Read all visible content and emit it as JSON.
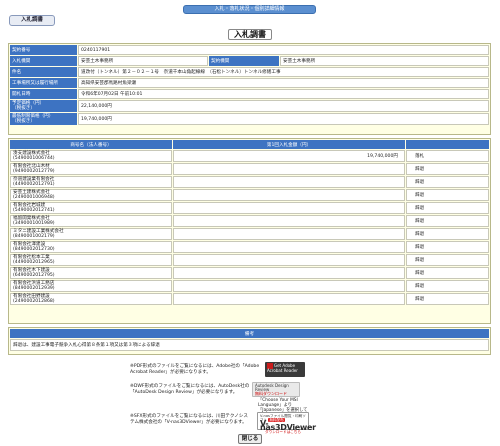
{
  "header": {
    "bar_title": "入札・落札状況・個別詳細情報",
    "tab_label": "入札調書",
    "page_title": "入札調書"
  },
  "info": {
    "rows": [
      {
        "label": "契約番号",
        "value": "0240117901"
      },
      {
        "label": "入札機関",
        "value": "安芸土木事務所",
        "label2": "契約機関",
        "value2": "安芸土木事務所"
      },
      {
        "label": "件名",
        "value": "道改付（トンネル）第２－０２－１号　奈道千本山角起線線　（石松トンネル）トンネル修繕工事"
      },
      {
        "label": "工事場所又は履行場所",
        "value": "高知県安芸郡馬路村魚梁瀬"
      },
      {
        "label": "開札日時",
        "value": "令和6年07月02日 午前10:01"
      },
      {
        "label": "予定価格（円）\n（税抜き）",
        "value": "22,140,000円"
      },
      {
        "label": "最低制限価格（円）\n（税抜き）",
        "value": "19,740,000円"
      }
    ]
  },
  "bids": {
    "headers": [
      "商号名（法人番号）",
      "第1回入札金額（円）",
      ""
    ],
    "rows": [
      {
        "name": "湊支建設株式会社",
        "id": "(5490001006744)",
        "amount": "19,740,000円",
        "result": "落札"
      },
      {
        "name": "有限会社北山木材",
        "id": "(9490002012779)",
        "amount": "",
        "result": "辞退"
      },
      {
        "name": "奈道建設業有限会社",
        "id": "(4490002012791)",
        "amount": "",
        "result": "辞退"
      },
      {
        "name": "安芸土建株式会社",
        "id": "(2490001006948)",
        "amount": "",
        "result": "辞退"
      },
      {
        "name": "有限会社岩城建",
        "id": "(5490002012741)",
        "amount": "",
        "result": "辞退"
      },
      {
        "name": "福留開発株式会社",
        "id": "(3490001001989)",
        "amount": "",
        "result": "辞退"
      },
      {
        "name": "ミタニ建設工業株式会社",
        "id": "(8490001002179)",
        "amount": "",
        "result": "辞退"
      },
      {
        "name": "有限会社澤建設",
        "id": "(8490002012730)",
        "amount": "",
        "result": "辞退"
      },
      {
        "name": "有限会社松本工業",
        "id": "(4490002012965)",
        "amount": "",
        "result": "辞退"
      },
      {
        "name": "有限会社木下建設",
        "id": "(6490002012795)",
        "amount": "",
        "result": "辞退"
      },
      {
        "name": "有限会社浜道工務店",
        "id": "(8490002012939)",
        "amount": "",
        "result": "辞退"
      },
      {
        "name": "有限会社田野建設",
        "id": "(2490002012868)",
        "amount": "",
        "result": "辞退"
      }
    ]
  },
  "remarks": {
    "heading": "備考",
    "text": "辞退は、建設工事電子競争入札心得第８条第１項又は第３項による辞退"
  },
  "notes": {
    "pdf": "※PDF形式のファイルをご覧になるには、Adobe社の「Adobe Acrobat Reader」が必要になります。",
    "dwf": "※DWF形式のファイルをご覧になるには、AutoDesk社の「AutoDesk Design Review」が必要になります。",
    "sfx": "※SFX形式のファイルをご覧になるには、川田テクノシステム株式会社の「V-nas3DViewer」が必要になります。",
    "dwf_side": "「Choose Your MSI Language」より「Japanese」を選択してください。",
    "acrobat_badge": "Get Adobe Acrobat Reader",
    "adr_badge_top": "Autodesk Design Review",
    "adr_badge_bottom": "無料ダウンロード",
    "vnas_top": "V-nasファイル閲覧・印刷ソフト",
    "vnas_big": "V-nas3DViewer",
    "vnas_bottom": "ダウンロードはこちら",
    "vnas_free": "無料配布"
  },
  "footer": {
    "close_label": "閉じる"
  }
}
